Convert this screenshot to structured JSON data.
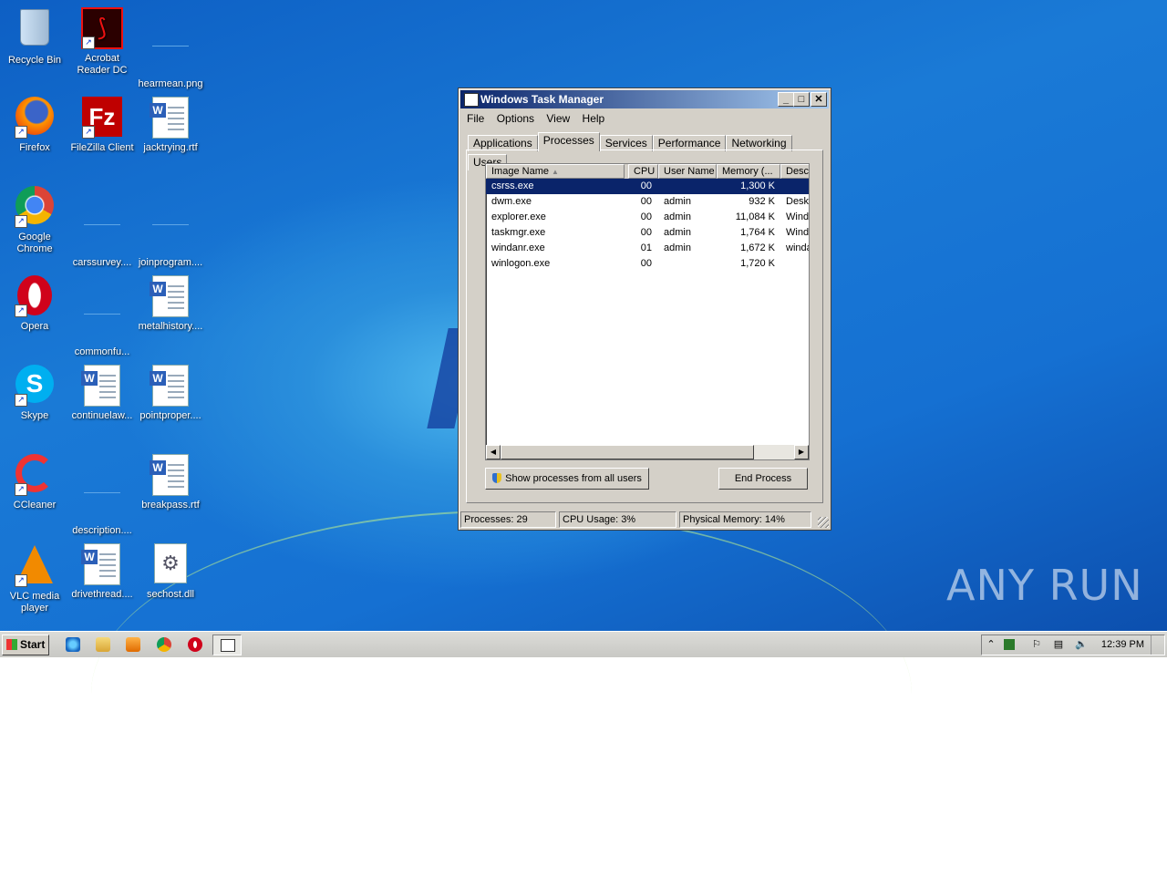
{
  "desktop": {
    "icons": [
      {
        "label": "Recycle Bin",
        "kind": "recycle-bin"
      },
      {
        "label": "Acrobat Reader DC",
        "kind": "acrobat"
      },
      {
        "label": "hearmean.png",
        "kind": "blank"
      },
      {
        "label": "Firefox",
        "kind": "firefox"
      },
      {
        "label": "FileZilla Client",
        "kind": "filezilla"
      },
      {
        "label": "jacktrying.rtf",
        "kind": "word-doc"
      },
      {
        "label": "Google Chrome",
        "kind": "chrome"
      },
      {
        "label": "carssurvey....",
        "kind": "blank"
      },
      {
        "label": "joinprogram....",
        "kind": "blank"
      },
      {
        "label": "Opera",
        "kind": "opera"
      },
      {
        "label": "commonfu...",
        "kind": "blank"
      },
      {
        "label": "metalhistory....",
        "kind": "word-doc"
      },
      {
        "label": "Skype",
        "kind": "skype"
      },
      {
        "label": "continuelaw...",
        "kind": "word-doc"
      },
      {
        "label": "pointproper....",
        "kind": "word-doc"
      },
      {
        "label": "CCleaner",
        "kind": "ccleaner"
      },
      {
        "label": "description....",
        "kind": "blank"
      },
      {
        "label": "breakpass.rtf",
        "kind": "word-doc"
      },
      {
        "label": "VLC media player",
        "kind": "vlc"
      },
      {
        "label": "drivethread....",
        "kind": "word-doc"
      },
      {
        "label": "sechost.dll",
        "kind": "dll"
      }
    ],
    "watermark": "ANY RUN"
  },
  "window": {
    "title": "Windows Task Manager",
    "menu": [
      "File",
      "Options",
      "View",
      "Help"
    ],
    "tabs": [
      "Applications",
      "Processes",
      "Services",
      "Performance",
      "Networking",
      "Users"
    ],
    "active_tab": "Processes",
    "columns": [
      "Image Name",
      "CPU",
      "User Name",
      "Memory (...",
      "Desc"
    ],
    "rows": [
      {
        "name": "csrss.exe",
        "cpu": "00",
        "user": "",
        "memory": "1,300 K",
        "desc": ""
      },
      {
        "name": "dwm.exe",
        "cpu": "00",
        "user": "admin",
        "memory": "932 K",
        "desc": "Desk"
      },
      {
        "name": "explorer.exe",
        "cpu": "00",
        "user": "admin",
        "memory": "11,084 K",
        "desc": "Wind"
      },
      {
        "name": "taskmgr.exe",
        "cpu": "00",
        "user": "admin",
        "memory": "1,764 K",
        "desc": "Wind"
      },
      {
        "name": "windanr.exe",
        "cpu": "01",
        "user": "admin",
        "memory": "1,672 K",
        "desc": "winda"
      },
      {
        "name": "winlogon.exe",
        "cpu": "00",
        "user": "",
        "memory": "1,720 K",
        "desc": ""
      }
    ],
    "selected_row": 0,
    "show_all_label": "Show processes from all users",
    "end_process_label": "End Process",
    "status": {
      "processes": "Processes: 29",
      "cpu": "CPU Usage: 3%",
      "memory": "Physical Memory: 14%"
    }
  },
  "taskbar": {
    "start_label": "Start",
    "quick_launch": [
      "internet-explorer-icon",
      "folder-icon",
      "media-player-icon",
      "chrome-icon",
      "opera-icon"
    ],
    "clock": "12:39 PM"
  }
}
